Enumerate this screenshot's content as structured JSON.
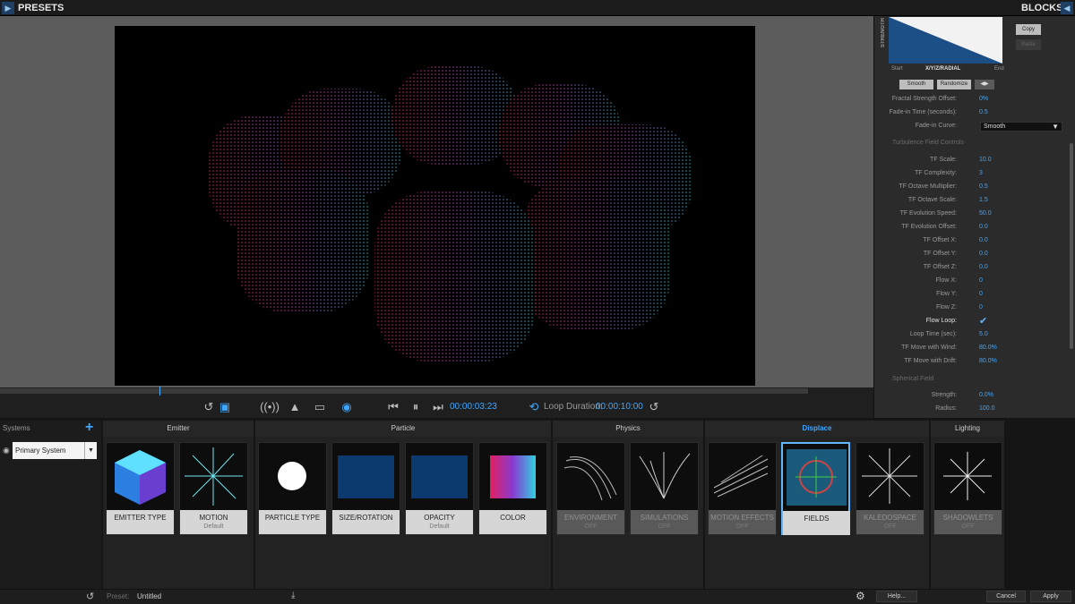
{
  "topbar": {
    "left_title": "PRESETS",
    "right_title": "BLOCKS"
  },
  "icons": {
    "expand": "chevron-right-icon",
    "collapse": "chevron-left-icon"
  },
  "colors": {
    "accent": "#3fa7ff",
    "panel": "#2b2b2b",
    "selected_border": "#62b8ff"
  },
  "transport": {
    "time": "00:00:03:23",
    "loop_label": "Loop Duration:",
    "loop_value": "00:00:10:00"
  },
  "graph": {
    "ylabel": "STRENGTH",
    "start": "Start",
    "mode": "X/Y/Z/RADIAL",
    "end": "End"
  },
  "side": {
    "copy": "Copy",
    "paste": "Paste",
    "smooth_btn": "Smooth",
    "randomize_btn": "Randomize",
    "rows_top": [
      {
        "k": "Fractal Strength Offset:",
        "v": "0%"
      },
      {
        "k": "Fade-in Time (seconds):",
        "v": "0.5"
      }
    ],
    "fade_curve_label": "Fade-in Curve:",
    "fade_curve_value": "Smooth",
    "section_tf": "Turbulence Field Controls",
    "rows_tf": [
      {
        "k": "TF Scale:",
        "v": "10.0"
      },
      {
        "k": "TF Complexity:",
        "v": "3"
      },
      {
        "k": "TF Octave Multiplier:",
        "v": "0.5"
      },
      {
        "k": "TF Octave Scale:",
        "v": "1.5"
      },
      {
        "k": "TF Evolution Speed:",
        "v": "50.0"
      },
      {
        "k": "TF Evolution Offset:",
        "v": "0.0"
      },
      {
        "k": "TF Offset X:",
        "v": "0.0"
      },
      {
        "k": "TF Offset Y:",
        "v": "0.0"
      },
      {
        "k": "TF Offset Z:",
        "v": "0.0"
      },
      {
        "k": "Flow X:",
        "v": "0"
      },
      {
        "k": "Flow Y:",
        "v": "0"
      },
      {
        "k": "Flow Z:",
        "v": "0"
      }
    ],
    "flow_loop_label": "Flow Loop:",
    "flow_loop_checked": true,
    "rows_loop": [
      {
        "k": "Loop Time (sec):",
        "v": "5.0"
      },
      {
        "k": "TF Move with Wind:",
        "v": "80.0%"
      },
      {
        "k": "TF Move with Drift:",
        "v": "80.0%"
      }
    ],
    "section_sf": "Spherical Field",
    "rows_sf": [
      {
        "k": "Strength:",
        "v": "0.0%"
      },
      {
        "k": "Radius:",
        "v": "100.0"
      }
    ]
  },
  "systems": {
    "header": "Systems",
    "selected": "Primary System"
  },
  "categories": {
    "emitter": "Emitter",
    "particle": "Particle",
    "physics": "Physics",
    "displace": "Displace",
    "lighting": "Lighting"
  },
  "tiles": {
    "emitter_type": {
      "label": "EMITTER TYPE",
      "sub": ""
    },
    "motion": {
      "label": "MOTION",
      "sub": "Default"
    },
    "particle_type": {
      "label": "PARTICLE TYPE",
      "sub": ""
    },
    "size_rotation": {
      "label": "SIZE/ROTATION",
      "sub": ""
    },
    "opacity": {
      "label": "OPACITY",
      "sub": "Default"
    },
    "color": {
      "label": "COLOR",
      "sub": ""
    },
    "environment": {
      "label": "ENVIRONMENT",
      "sub": "OFF"
    },
    "simulations": {
      "label": "SIMULATIONS",
      "sub": "OFF"
    },
    "motion_effects": {
      "label": "MOTION EFFECTS",
      "sub": "OFF"
    },
    "fields": {
      "label": "FIELDS",
      "sub": ""
    },
    "kaleidospace": {
      "label": "KALEDOSPACE",
      "sub": "OFF"
    },
    "shadowlets": {
      "label": "SHADOWLETS",
      "sub": "OFF"
    }
  },
  "status": {
    "preset_label": "Preset:",
    "preset_value": "Untitled",
    "help": "Help...",
    "cancel": "Cancel",
    "apply": "Apply"
  }
}
